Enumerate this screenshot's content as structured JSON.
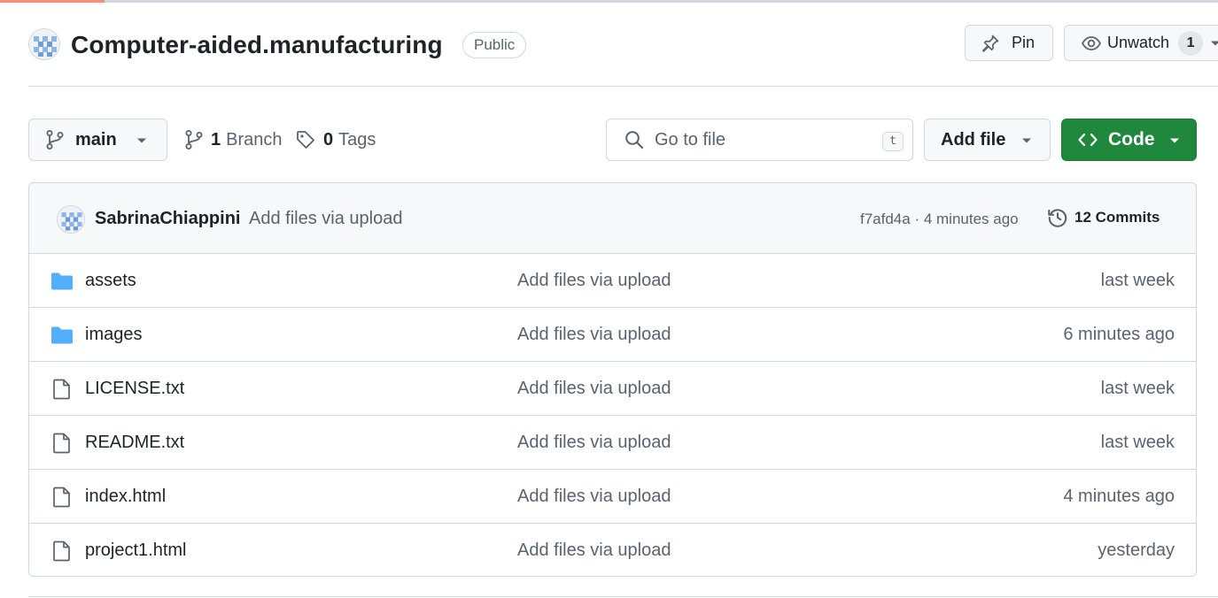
{
  "repo": {
    "name": "Computer-aided.manufacturing",
    "visibility": "Public",
    "pin_label": "Pin",
    "watch_label": "Unwatch",
    "watch_count": "1"
  },
  "toolbar": {
    "branch_name": "main",
    "branches_count": "1",
    "branches_label": "Branch",
    "tags_count": "0",
    "tags_label": "Tags",
    "search_placeholder": "Go to file",
    "search_shortcut": "t",
    "add_file_label": "Add file",
    "code_label": "Code"
  },
  "commit": {
    "author": "SabrinaChiappini",
    "message": "Add files via upload",
    "hash_time": "f7afd4a · 4 minutes ago",
    "commits_label": "12 Commits"
  },
  "files": [
    {
      "name": "assets",
      "type": "folder",
      "message": "Add files via upload",
      "date": "last week"
    },
    {
      "name": "images",
      "type": "folder",
      "message": "Add files via upload",
      "date": "6 minutes ago"
    },
    {
      "name": "LICENSE.txt",
      "type": "file",
      "message": "Add files via upload",
      "date": "last week"
    },
    {
      "name": "README.txt",
      "type": "file",
      "message": "Add files via upload",
      "date": "last week"
    },
    {
      "name": "index.html",
      "type": "file",
      "message": "Add files via upload",
      "date": "4 minutes ago"
    },
    {
      "name": "project1.html",
      "type": "file",
      "message": "Add files via upload",
      "date": "yesterday"
    }
  ],
  "colors": {
    "primary_button": "#1f883d",
    "folder_icon": "#54aeff",
    "tab_accent": "#fd8c73"
  }
}
